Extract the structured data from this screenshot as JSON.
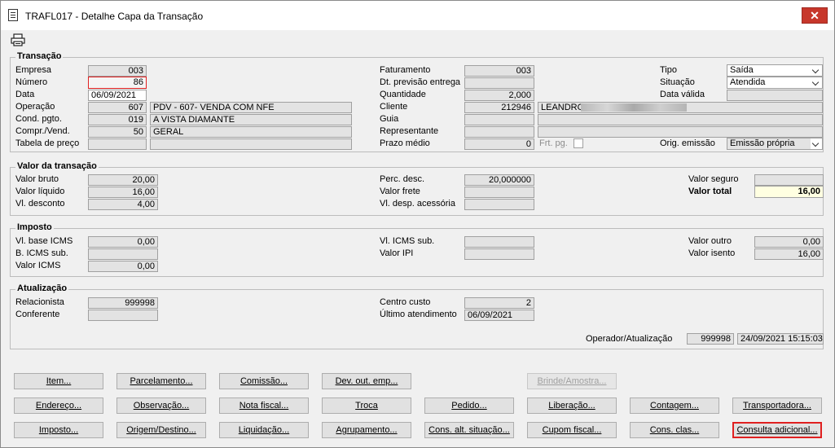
{
  "window": {
    "title": "TRAFL017 - Detalhe Capa da Transação",
    "close_glyph": "✕"
  },
  "transacao": {
    "legend": "Transação",
    "labels": {
      "empresa": "Empresa",
      "numero": "Número",
      "data": "Data",
      "operacao": "Operação",
      "cond_pgto": "Cond. pgto.",
      "compr_vend": "Compr./Vend.",
      "tabela_preco": "Tabela de preço",
      "faturamento": "Faturamento",
      "dt_previsao": "Dt. previsão entrega",
      "quantidade": "Quantidade",
      "cliente": "Cliente",
      "guia": "Guia",
      "representante": "Representante",
      "prazo_medio": "Prazo médio",
      "frt_pg": "Frt. pg.",
      "tipo": "Tipo",
      "situacao": "Situação",
      "data_valida": "Data válida",
      "orig_emissao": "Orig. emissão"
    },
    "values": {
      "empresa": "003",
      "numero": "86",
      "data": "06/09/2021",
      "operacao_code": "607",
      "operacao_desc": "PDV - 607- VENDA COM NFE",
      "cond_pgto_code": "019",
      "cond_pgto_desc": "A VISTA DIAMANTE",
      "compr_vend_code": "50",
      "compr_vend_desc": "GERAL",
      "tabela_preco_code": "",
      "tabela_preco_desc": "",
      "faturamento": "003",
      "dt_previsao": "",
      "quantidade": "2,000",
      "cliente_code": "212946",
      "cliente_name": "LEANDRO",
      "guia": "",
      "representante": "",
      "prazo_medio": "0",
      "tipo": "Saída",
      "situacao": "Atendida",
      "data_valida": "",
      "orig_emissao": "Emissão própria"
    }
  },
  "valor": {
    "legend": "Valor da transação",
    "labels": {
      "valor_bruto": "Valor bruto",
      "valor_liquido": "Valor líquido",
      "vl_desconto": "Vl. desconto",
      "perc_desc": "Perc. desc.",
      "valor_frete": "Valor frete",
      "vl_desp_acessoria": "Vl. desp. acessória",
      "valor_seguro": "Valor seguro",
      "valor_total": "Valor total"
    },
    "values": {
      "valor_bruto": "20,00",
      "valor_liquido": "16,00",
      "vl_desconto": "4,00",
      "perc_desc": "20,000000",
      "valor_frete": "",
      "vl_desp_acessoria": "",
      "valor_seguro": "",
      "valor_total": "16,00"
    }
  },
  "imposto": {
    "legend": "Imposto",
    "labels": {
      "vl_base_icms": "Vl. base ICMS",
      "b_icms_sub": "B. ICMS sub.",
      "valor_icms": "Valor ICMS",
      "vl_icms_sub": "Vl. ICMS sub.",
      "valor_ipi": "Valor IPI",
      "valor_outro": "Valor outro",
      "valor_isento": "Valor isento"
    },
    "values": {
      "vl_base_icms": "0,00",
      "b_icms_sub": "",
      "valor_icms": "0,00",
      "vl_icms_sub": "",
      "valor_ipi": "",
      "valor_outro": "0,00",
      "valor_isento": "16,00"
    }
  },
  "atualizacao": {
    "legend": "Atualização",
    "labels": {
      "relacionista": "Relacionista",
      "conferente": "Conferente",
      "centro_custo": "Centro custo",
      "ultimo_atendimento": "Último atendimento",
      "operador_atualizacao": "Operador/Atualização"
    },
    "values": {
      "relacionista": "999998",
      "conferente": "",
      "centro_custo": "2",
      "ultimo_atendimento": "06/09/2021",
      "operador": "999998",
      "data_atualizacao": "24/09/2021 15:15:03"
    }
  },
  "buttons": {
    "item": "Item...",
    "parcelamento": "Parcelamento...",
    "comissao": "Comissão...",
    "dev_out_emp": "Dev. out. emp...",
    "brinde_amostra": "Brinde/Amostra...",
    "endereco": "Endereço...",
    "observacao": "Observação...",
    "nota_fiscal": "Nota fiscal...",
    "troca": "Troca",
    "pedido": "Pedido...",
    "liberacao": "Liberação...",
    "contagem": "Contagem...",
    "transportadora": "Transportadora...",
    "imposto": "Imposto...",
    "origem_destino": "Origem/Destino...",
    "liquidacao": "Liquidação...",
    "agrupamento": "Agrupamento...",
    "cons_alt_situacao": "Cons. alt. situação...",
    "cupom_fiscal": "Cupom fiscal...",
    "cons_clas": "Cons. clas...",
    "consulta_adicional": "Consulta adicional..."
  }
}
